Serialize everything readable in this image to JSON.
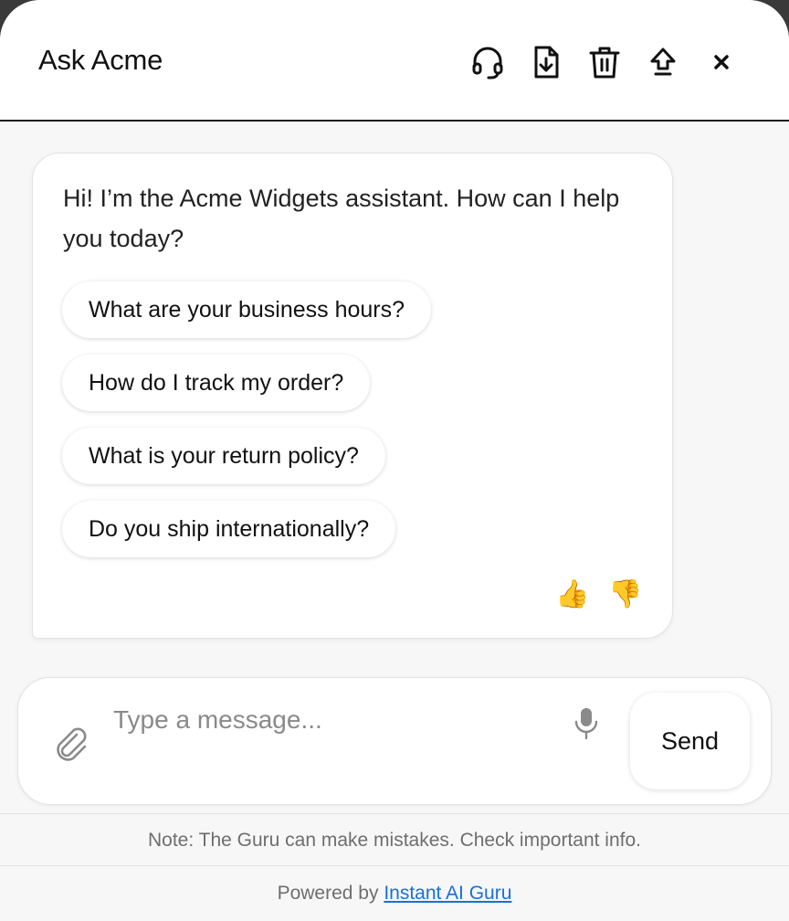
{
  "header": {
    "title": "Ask Acme",
    "icons": [
      "headset-icon",
      "download-file-icon",
      "trash-icon",
      "expand-arrow-icon",
      "close-icon"
    ]
  },
  "message": {
    "greeting": "Hi! I’m the Acme Widgets assistant. How can I help you today?",
    "suggestions": [
      "What are your business hours?",
      "How do I track my order?",
      "What is your return policy?",
      "Do you ship internationally?"
    ],
    "thumbs_up": "👍",
    "thumbs_down": "👎"
  },
  "composer": {
    "placeholder": "Type a message...",
    "value": "",
    "send_label": "Send"
  },
  "footer": {
    "note": "Note: The Guru can make mistakes. Check important info.",
    "powered_prefix": "Powered by ",
    "powered_link": "Instant AI Guru"
  },
  "colors": {
    "link": "#1a6fd8",
    "background": "#f7f7f7",
    "header_border": "#1f1f1f"
  }
}
